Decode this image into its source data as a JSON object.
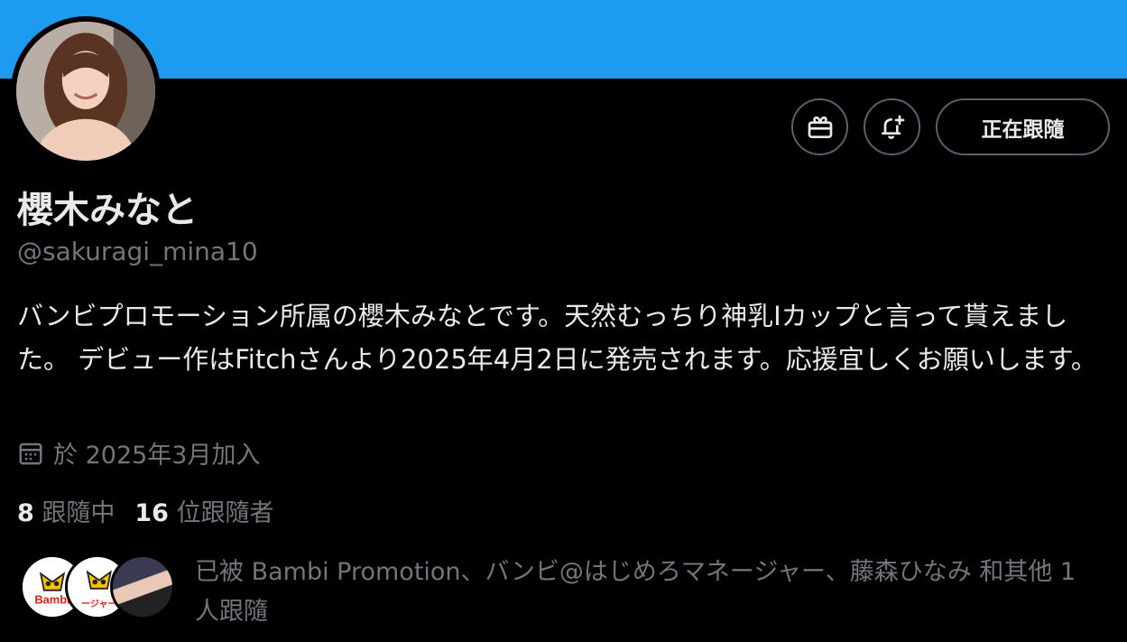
{
  "profile": {
    "name": "櫻木みなと",
    "handle": "@sakuragi_mina10",
    "bio": "バンビプロモーション所属の櫻木みなとです。天然むっちり神乳Iカップと言って貰えました。 デビュー作はFitchさんより2025年4月2日に発売されます。応援宜しくお願いします。",
    "joined": "於 2025年3月加入"
  },
  "actions": {
    "follow_label": "正在跟隨",
    "gift_icon": "gift-icon",
    "notify_icon": "bell-plus-icon"
  },
  "stats": {
    "following_count": "8",
    "following_label": "跟隨中",
    "followers_count": "16",
    "followers_label": "位跟隨者"
  },
  "known_followers": {
    "text": "已被 Bambi Promotion、バンビ@はじめろマネージャー、藤森ひなみ 和其他 1 人跟隨",
    "avatar1_label": "Bambi",
    "avatar2_label": "ージャー"
  },
  "colors": {
    "banner": "#1d9bf0",
    "background": "#000000",
    "text_primary": "#e7e9ea",
    "text_secondary": "#71767b",
    "border": "#536471"
  }
}
